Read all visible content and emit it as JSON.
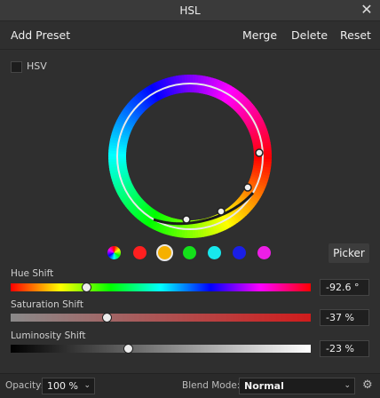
{
  "window": {
    "title": "HSL",
    "close_icon": "close-icon"
  },
  "toolbar": {
    "add_preset": "Add Preset",
    "merge": "Merge",
    "delete": "Delete",
    "reset": "Reset"
  },
  "hsv": {
    "label": "HSV",
    "checked": false
  },
  "wheel": {
    "handles_hue_deg": [
      42,
      50,
      100,
      165,
      340
    ]
  },
  "swatches": [
    {
      "name": "master",
      "color": "multicolor",
      "selected": false
    },
    {
      "name": "red",
      "color": "#ff1f1f",
      "selected": false
    },
    {
      "name": "yellow",
      "color": "#f5b000",
      "selected": true
    },
    {
      "name": "green",
      "color": "#14e01a",
      "selected": false
    },
    {
      "name": "cyan",
      "color": "#17e8ee",
      "selected": false
    },
    {
      "name": "blue",
      "color": "#1a1fe6",
      "selected": false
    },
    {
      "name": "magenta",
      "color": "#ee1ee6",
      "selected": false
    }
  ],
  "picker": {
    "label": "Picker"
  },
  "sliders": {
    "hue": {
      "label": "Hue Shift",
      "value": "-92.6 °",
      "fraction": 0.25
    },
    "saturation": {
      "label": "Saturation Shift",
      "value": "-37 %",
      "fraction": 0.32
    },
    "luminosity": {
      "label": "Luminosity Shift",
      "value": "-23 %",
      "fraction": 0.39
    }
  },
  "bottom": {
    "opacity_label": "Opacity:",
    "opacity_value": "100 %",
    "blend_label": "Blend Mode:",
    "blend_value": "Normal",
    "settings_icon": "gear-icon"
  }
}
